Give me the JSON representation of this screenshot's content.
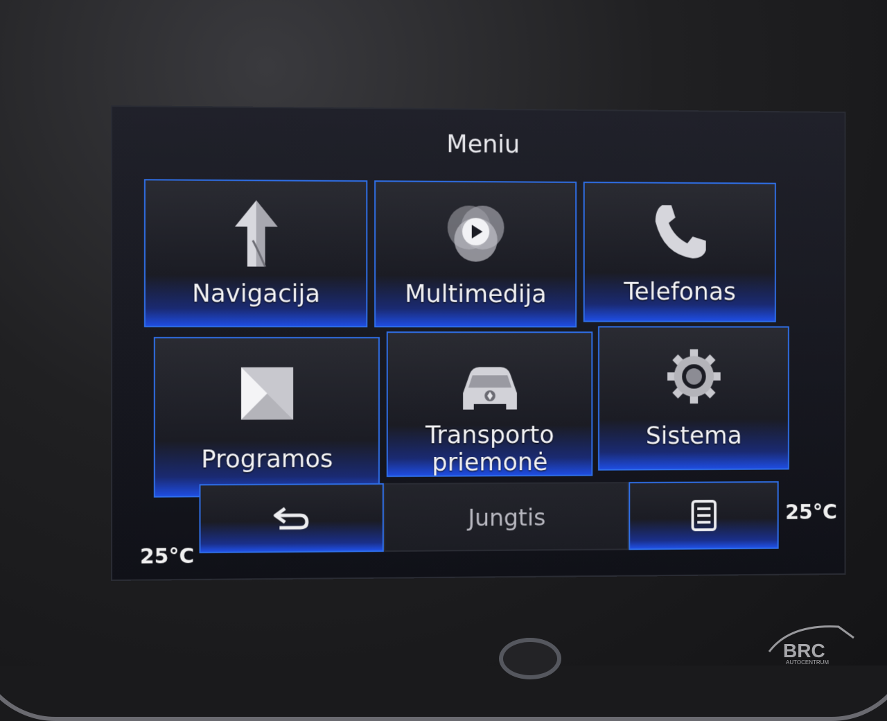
{
  "header": {
    "title": "Meniu"
  },
  "tiles": [
    {
      "label": "Navigacija",
      "icon": "navigation-arrow-icon"
    },
    {
      "label": "Multimedija",
      "icon": "multimedia-play-icon"
    },
    {
      "label": "Telefonas",
      "icon": "phone-icon"
    },
    {
      "label": "Programos",
      "icon": "apps-icon"
    },
    {
      "label_line1": "Transporto",
      "label_line2": "priemonė",
      "icon": "vehicle-icon"
    },
    {
      "label": "Sistema",
      "icon": "gear-icon"
    }
  ],
  "bottom_bar": {
    "back_icon": "back-arrow-icon",
    "center_label": "Jungtis",
    "menu_icon": "list-menu-icon"
  },
  "climate": {
    "left_temp": "25°C",
    "right_temp": "25°C"
  },
  "watermark": {
    "text": "BRC",
    "subtext": "AUTOCENTRUM"
  },
  "colors": {
    "accent": "#2f6fe8",
    "tile_glow": "#1e4ce0",
    "text": "#f2f2f5"
  }
}
